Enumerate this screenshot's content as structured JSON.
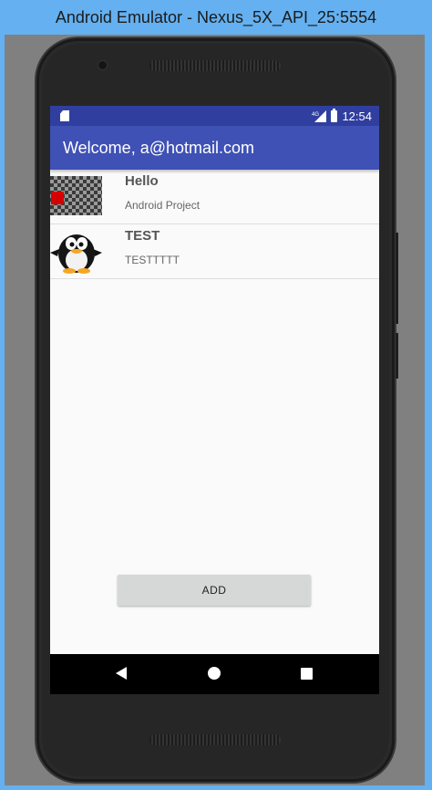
{
  "window": {
    "title": "Android Emulator - Nexus_5X_API_25:5554"
  },
  "status_bar": {
    "network": "4G",
    "time": "12:54"
  },
  "app_bar": {
    "title": "Welcome, a@hotmail.com"
  },
  "list": [
    {
      "title": "Hello",
      "subtitle": "Android Project",
      "icon": "checkerboard-image"
    },
    {
      "title": "TEST",
      "subtitle": "TESTTTTT",
      "icon": "penguin-image"
    }
  ],
  "actions": {
    "add_label": "ADD"
  },
  "nav_bar": {
    "icons": [
      "back-icon",
      "home-icon",
      "recents-icon"
    ]
  },
  "colors": {
    "status_bar": "#303f9f",
    "app_bar": "#3f51b5",
    "button": "#d6d7d7"
  }
}
